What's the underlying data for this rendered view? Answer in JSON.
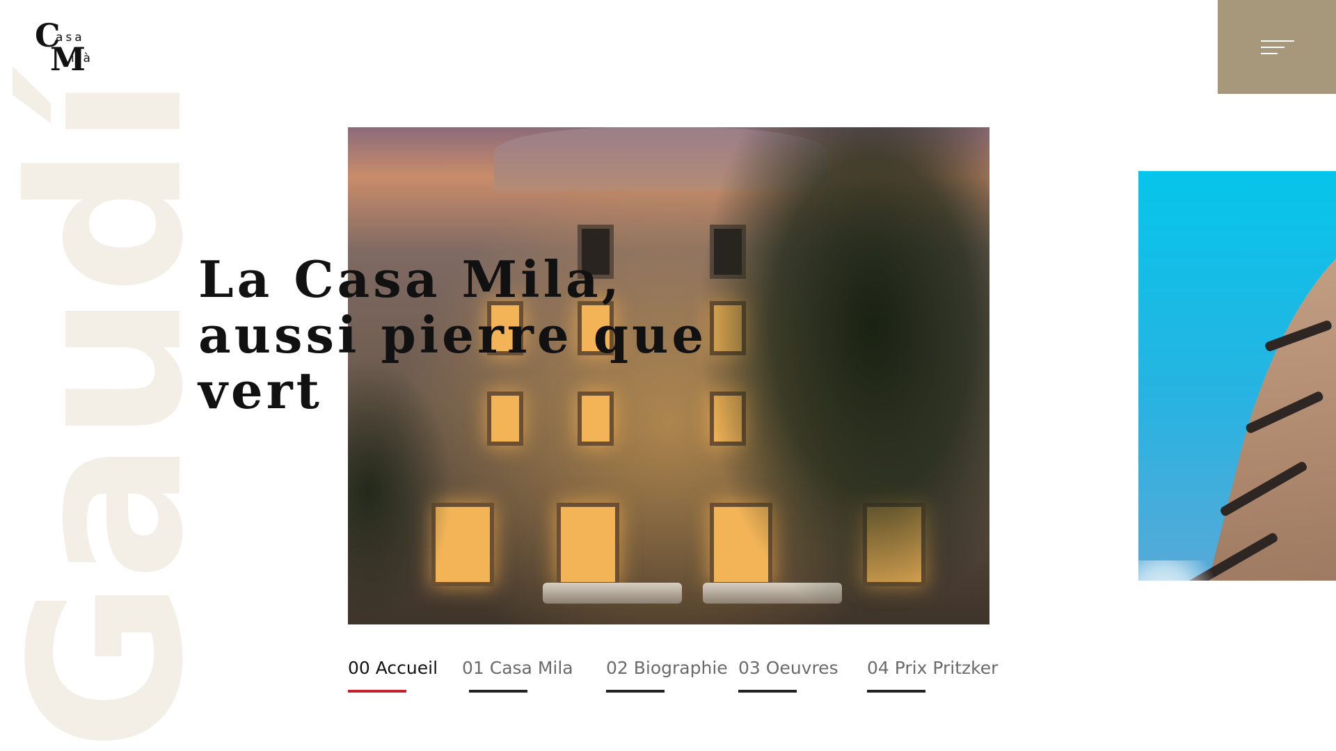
{
  "brand": {
    "logo_letter_1": "C",
    "logo_text_1": "asa",
    "logo_letter_2": "M",
    "logo_text_2": "ilà"
  },
  "menu": {
    "icon": "hamburger-menu-icon",
    "color": "#a7987c"
  },
  "background_word": "Gaudí",
  "hero": {
    "headline": "La Casa Mila,\naussi pierre que\nvert"
  },
  "nav": {
    "items": [
      {
        "label": "00 Accueil",
        "active": true
      },
      {
        "label": "01 Casa Mila",
        "active": false
      },
      {
        "label": "02 Biographie",
        "active": false
      },
      {
        "label": "03 Oeuvres",
        "active": false
      },
      {
        "label": "04 Prix Pritzker",
        "active": false
      }
    ],
    "active_color": "#c8202a",
    "inactive_color": "#222222"
  }
}
